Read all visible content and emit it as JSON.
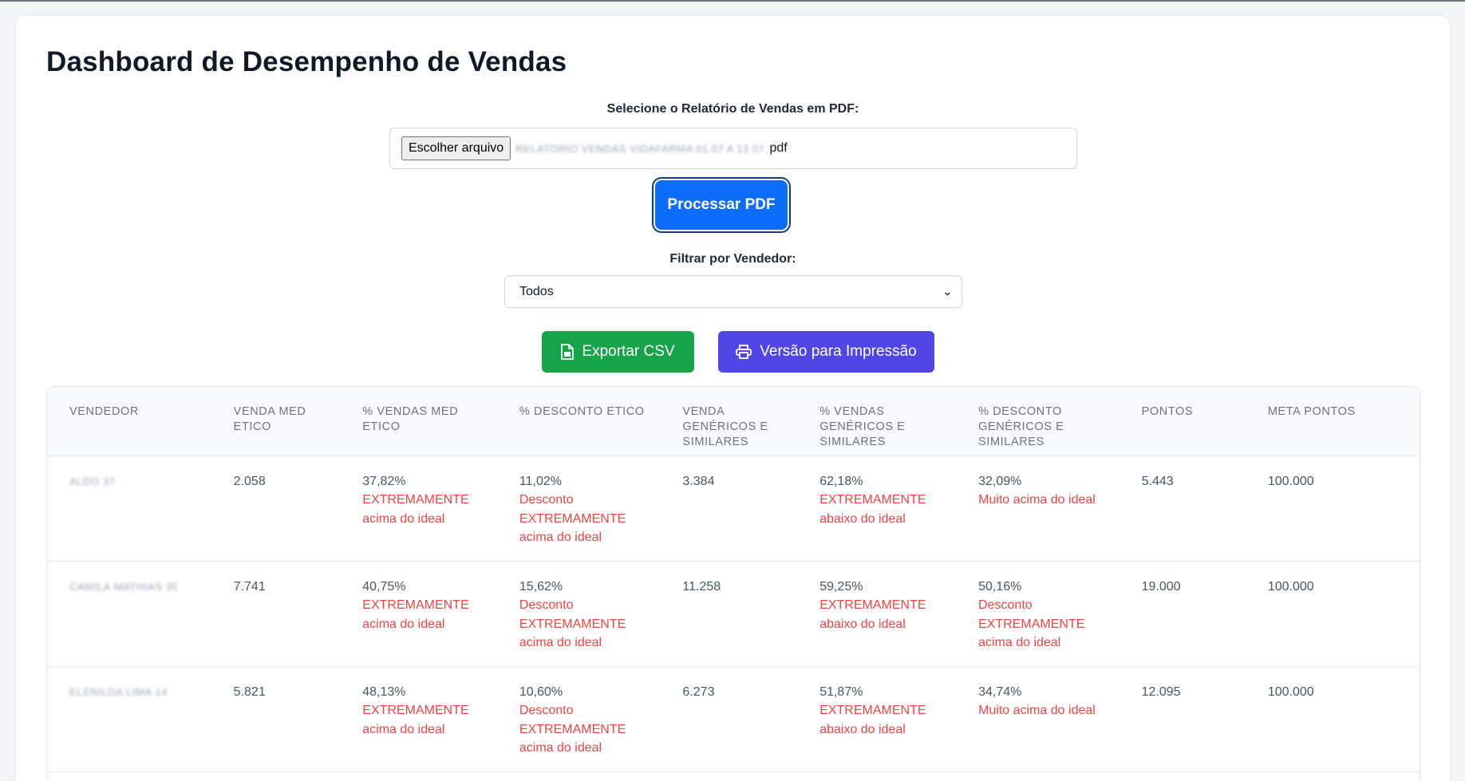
{
  "page": {
    "title": "Dashboard de Desempenho de Vendas"
  },
  "upload": {
    "label": "Selecione o Relatório de Vendas em PDF:",
    "choose_button": "Escolher arquivo",
    "file_name_blurred": "RELATORIO VENDAS VIDAFARMA 01.07 A 13.07.",
    "file_ext": "pdf",
    "process_button": "Processar PDF"
  },
  "filter": {
    "label": "Filtrar por Vendedor:",
    "selected": "Todos"
  },
  "actions": {
    "export_csv": "Exportar CSV",
    "print_version": "Versão para Impressão"
  },
  "colors": {
    "primary": "#0d6efd",
    "export_green": "#16a34a",
    "print_indigo": "#4f46e5",
    "warning_red": "#ef4444"
  },
  "table": {
    "headers": [
      "VENDEDOR",
      "VENDA MED ETICO",
      "% VENDAS MED ETICO",
      "% DESCONTO ETICO",
      "VENDA GENÉRICOS E SIMILARES",
      "% VENDAS GENÉRICOS E SIMILARES",
      "% DESCONTO GENÉRICOS E SIMILARES",
      "PONTOS",
      "META PONTOS"
    ],
    "rows": [
      {
        "seller": "ALDO 37",
        "venda_med_etico": "2.058",
        "pct_vendas_med_etico": "37,82%",
        "pct_vendas_med_etico_note": "EXTREMAMENTE acima do ideal",
        "pct_desc_etico": "11,02%",
        "pct_desc_etico_note": "Desconto EXTREMAMENTE acima do ideal",
        "venda_genericos": "3.384",
        "pct_vendas_genericos": "62,18%",
        "pct_vendas_genericos_note": "EXTREMAMENTE abaixo do ideal",
        "pct_desc_genericos": "32,09%",
        "pct_desc_genericos_note": "Muito acima do ideal",
        "pontos": "5.443",
        "meta_pontos": "100.000"
      },
      {
        "seller": "CAMILA MATHIAS 35",
        "venda_med_etico": "7.741",
        "pct_vendas_med_etico": "40,75%",
        "pct_vendas_med_etico_note": "EXTREMAMENTE acima do ideal",
        "pct_desc_etico": "15,62%",
        "pct_desc_etico_note": "Desconto EXTREMAMENTE acima do ideal",
        "venda_genericos": "11.258",
        "pct_vendas_genericos": "59,25%",
        "pct_vendas_genericos_note": "EXTREMAMENTE abaixo do ideal",
        "pct_desc_genericos": "50,16%",
        "pct_desc_genericos_note": "Desconto EXTREMAMENTE acima do ideal",
        "pontos": "19.000",
        "meta_pontos": "100.000"
      },
      {
        "seller": "ELENILDA LIMA 14",
        "venda_med_etico": "5.821",
        "pct_vendas_med_etico": "48,13%",
        "pct_vendas_med_etico_note": "EXTREMAMENTE acima do ideal",
        "pct_desc_etico": "10,60%",
        "pct_desc_etico_note": "Desconto EXTREMAMENTE acima do ideal",
        "venda_genericos": "6.273",
        "pct_vendas_genericos": "51,87%",
        "pct_vendas_genericos_note": "EXTREMAMENTE abaixo do ideal",
        "pct_desc_genericos": "34,74%",
        "pct_desc_genericos_note": "Muito acima do ideal",
        "pontos": "12.095",
        "meta_pontos": "100.000"
      }
    ]
  }
}
